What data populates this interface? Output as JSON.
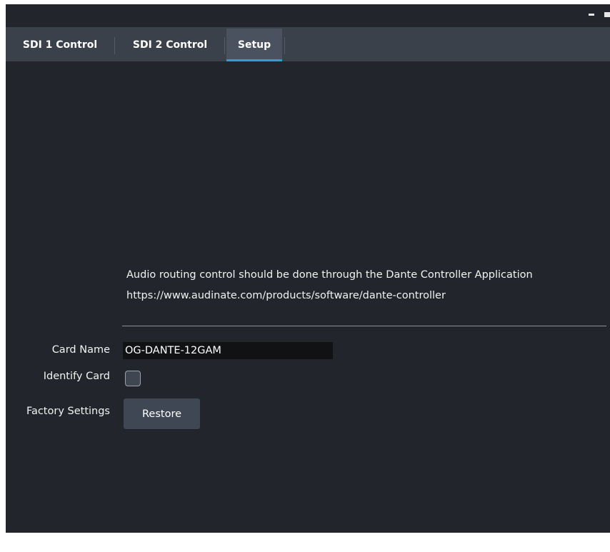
{
  "tabs": [
    {
      "label": "SDI 1 Control",
      "active": false
    },
    {
      "label": "SDI 2 Control",
      "active": false
    },
    {
      "label": "Setup",
      "active": true
    }
  ],
  "info": {
    "line1": "Audio routing control should be done through the Dante Controller Application",
    "line2": "https://www.audinate.com/products/software/dante-controller"
  },
  "form": {
    "card_name_label": "Card Name",
    "card_name_value": "OG-DANTE-12GAM",
    "identify_card_label": "Identify Card",
    "identify_card_checked": false,
    "factory_settings_label": "Factory Settings",
    "restore_button_label": "Restore"
  },
  "colors": {
    "background": "#22262c",
    "tabbar": "#3b414a",
    "active_tab_indicator": "#2a9fd8",
    "input_background": "#111214",
    "button_background": "#3f4754"
  }
}
